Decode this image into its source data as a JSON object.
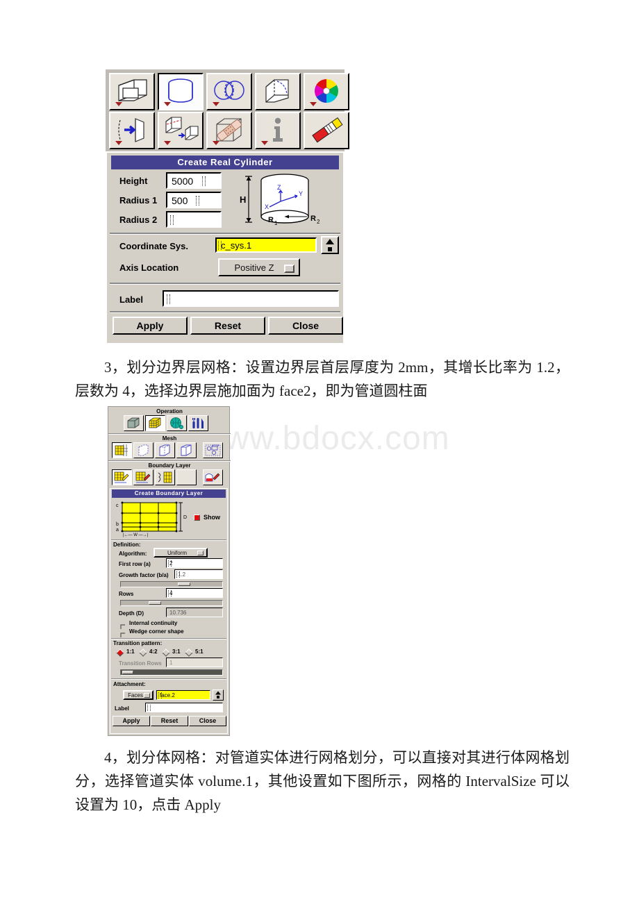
{
  "document": {
    "watermark": "www.bdocx.com",
    "paragraphs": [
      {
        "id": "step3",
        "text": "3，划分边界层网格：设置边界层首层厚度为 2mm，其增长比率为 1.2，层数为 4，选择边界层施加面为 face2，即为管道圆柱面"
      },
      {
        "id": "step4",
        "text": "4，划分体网格：对管道实体进行网格划分，可以直接对其进行体网格划分，选择管道实体 volume.1，其他设置如下图所示，网格的 IntervalSize 可以设置为 10，点击 Apply"
      }
    ]
  },
  "cylinder_panel": {
    "toolbar": {
      "row1": [
        {
          "icon": "brick-volume-icon",
          "label": "Create Brick",
          "selected": false,
          "has_arrow": true
        },
        {
          "icon": "cylinder-volume-icon",
          "label": "Create Cylinder",
          "selected": true,
          "has_arrow": true
        },
        {
          "icon": "boolean-union-icon",
          "label": "Boolean Operations",
          "selected": false,
          "has_arrow": true
        },
        {
          "icon": "split-volume-icon",
          "label": "Split Volume",
          "selected": false,
          "has_arrow": false
        },
        {
          "icon": "color-wheel-icon",
          "label": "Volume Color",
          "selected": false,
          "has_arrow": true
        }
      ],
      "row2": [
        {
          "icon": "move-copy-volume-icon",
          "label": "Move / Copy Volumes",
          "selected": false,
          "has_arrow": true
        },
        {
          "icon": "split-merge-volume-icon",
          "label": "Split / Merge Volumes",
          "selected": false,
          "has_arrow": true
        },
        {
          "icon": "stitch-volume-icon",
          "label": "Stitch Faces",
          "selected": false,
          "has_arrow": true
        },
        {
          "icon": "summarize-info-icon",
          "label": "Summarize Volume",
          "selected": false,
          "has_arrow": true
        },
        {
          "icon": "delete-eraser-icon",
          "label": "Delete Volumes",
          "selected": false,
          "has_arrow": false
        }
      ]
    },
    "title": "Create Real Cylinder",
    "fields": {
      "height_label": "Height",
      "height_value": "5000",
      "radius1_label": "Radius 1",
      "radius1_value": "500",
      "radius2_label": "Radius 2",
      "radius2_value": "",
      "coord_label": "Coordinate Sys.",
      "coord_value": "c_sys.1",
      "axis_label": "Axis Location",
      "axis_value": "Positive Z",
      "label_label": "Label",
      "label_value": ""
    },
    "diagram": {
      "h_label": "H",
      "r1_label": "R",
      "r1_sub": "1",
      "r2_label": "R",
      "r2_sub": "2",
      "axis_z": "Z",
      "axis_y": "Y",
      "axis_x": "X"
    },
    "buttons": {
      "apply": "Apply",
      "reset": "Reset",
      "close": "Close"
    }
  },
  "bl_panel": {
    "groups": {
      "operation_header": "Operation",
      "mesh_header": "Mesh",
      "bl_header": "Boundary Layer"
    },
    "operation_icons": [
      {
        "icon": "geometry-cube-icon",
        "selected": false
      },
      {
        "icon": "mesh-cube-icon",
        "selected": true
      },
      {
        "icon": "zones-globe-icon",
        "selected": false
      },
      {
        "icon": "tools-icon",
        "selected": false
      }
    ],
    "mesh_icons": [
      {
        "icon": "boundary-layer-mesh-icon",
        "selected": true
      },
      {
        "icon": "mesh-edge-icon",
        "selected": false
      },
      {
        "icon": "mesh-face-icon",
        "selected": false
      },
      {
        "icon": "mesh-volume-icon",
        "selected": false
      },
      {
        "icon": "mesh-group-icon",
        "selected": false
      }
    ],
    "bl_icons": [
      {
        "icon": "create-boundary-layer-icon",
        "selected": true
      },
      {
        "icon": "modify-boundary-layer-icon",
        "selected": false
      },
      {
        "icon": "split-boundary-layer-icon",
        "selected": false
      },
      {
        "icon": "blank-icon",
        "selected": false
      },
      {
        "icon": "delete-boundary-layer-icon",
        "selected": false
      }
    ],
    "title": "Create Boundary Layer",
    "preview": {
      "label_a": "a",
      "label_b": "b",
      "label_c": "c",
      "label_d": "D",
      "label_w": "|←  W  →|",
      "show_label": "Show",
      "show_checked": true
    },
    "definition": {
      "header": "Definition:",
      "algorithm_label": "Algorithm:",
      "algorithm_value": "Uniform",
      "first_row_label": "First row (a)",
      "first_row_value": "2",
      "growth_label": "Growth factor (b/a)",
      "growth_value": "1.2",
      "rows_label": "Rows",
      "rows_value": "4",
      "depth_label": "Depth (D)",
      "depth_value": "10.736",
      "internal_continuity_label": "Internal continuity",
      "internal_continuity_checked": false,
      "wedge_corner_label": "Wedge corner shape",
      "wedge_corner_checked": false
    },
    "transition": {
      "header": "Transition pattern:",
      "options": [
        {
          "label": "1:1",
          "selected": true
        },
        {
          "label": "4:2",
          "selected": false
        },
        {
          "label": "3:1",
          "selected": false
        },
        {
          "label": "5:1",
          "selected": false
        }
      ],
      "rows_label": "Transition Rows",
      "rows_value": "1"
    },
    "attachment": {
      "header": "Attachment:",
      "type_value": "Faces",
      "face_value": "face.2",
      "label_label": "Label",
      "label_value": ""
    },
    "buttons": {
      "apply": "Apply",
      "reset": "Reset",
      "close": "Close"
    }
  },
  "colors": {
    "titlebar": "#454191",
    "panel": "#d4d0c8",
    "highlight_yellow": "#ffff00",
    "accent_red": "#e01010",
    "icon_blue": "#3333cc"
  }
}
